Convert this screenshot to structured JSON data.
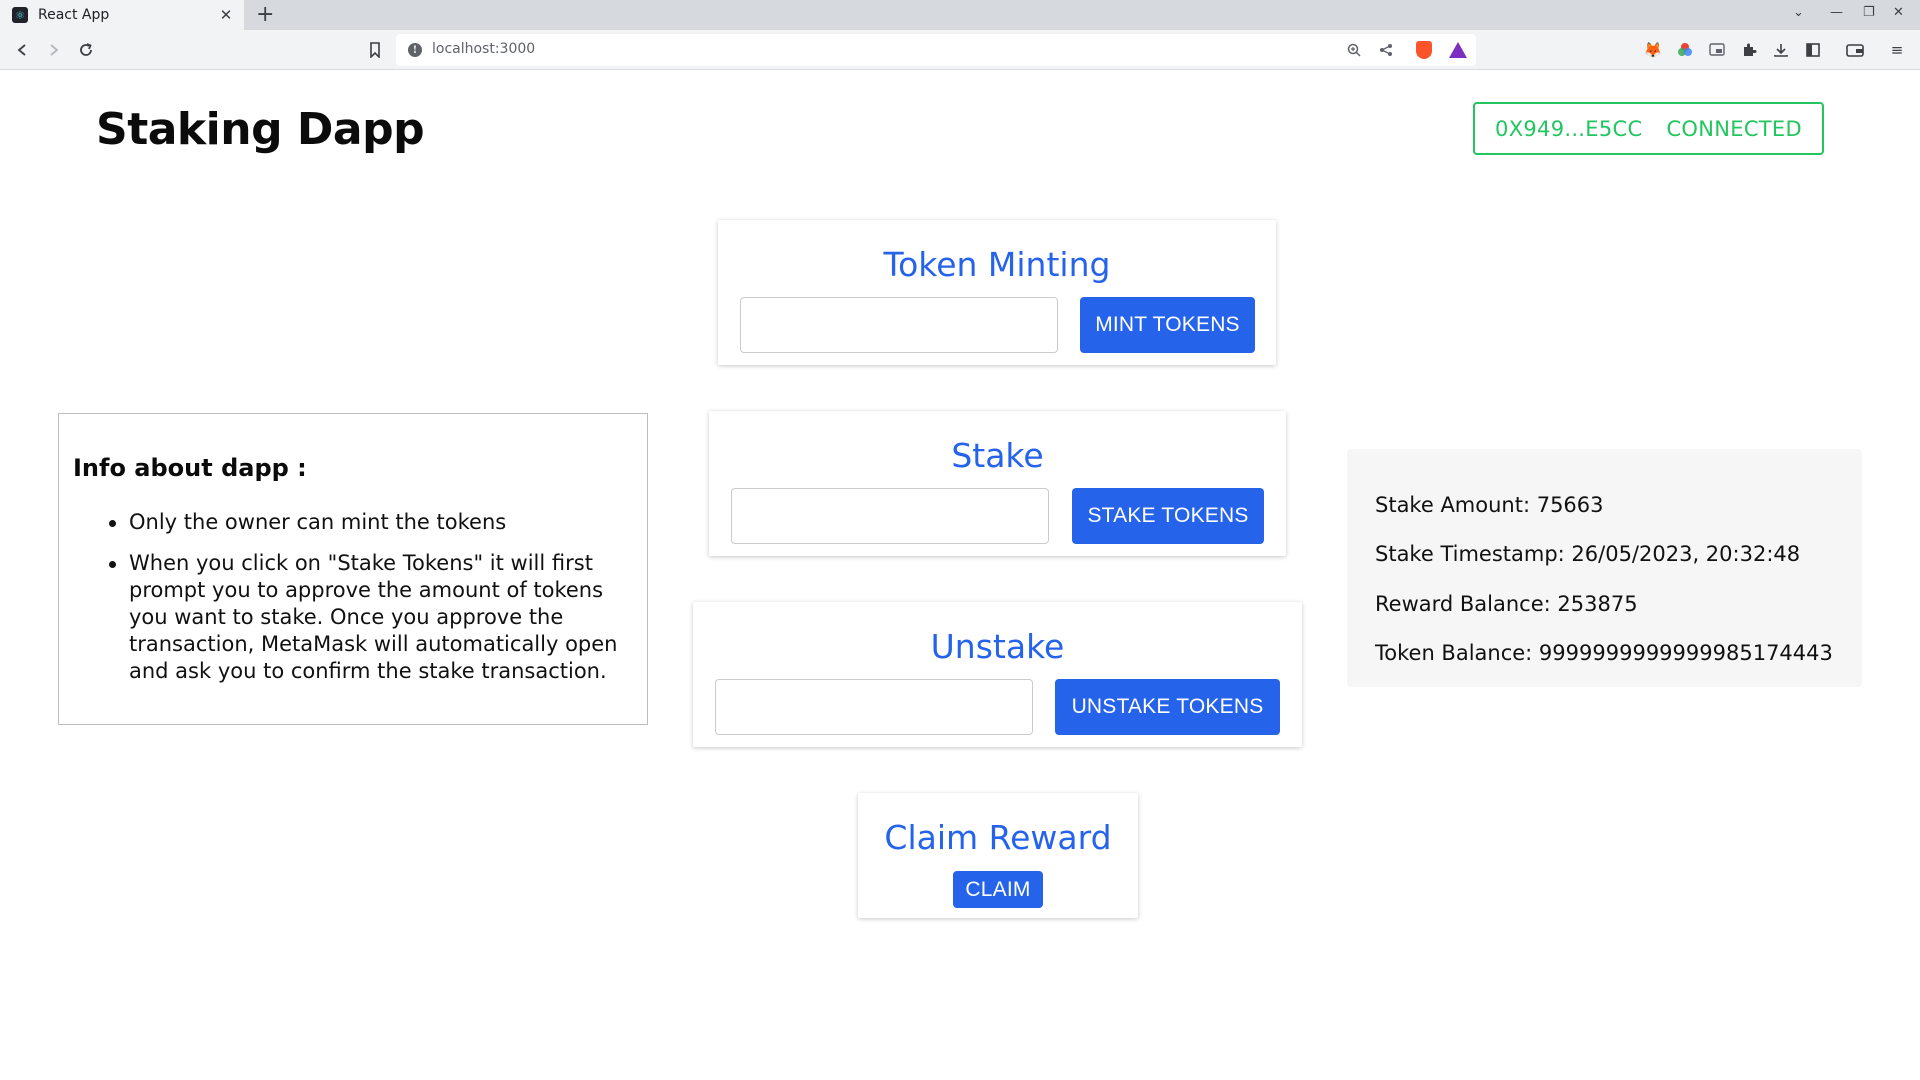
{
  "browser": {
    "tab_title": "React App",
    "url": "localhost:3000"
  },
  "header": {
    "app_title": "Staking Dapp",
    "wallet_address": "0X949...E5CC",
    "wallet_status": "CONNECTED",
    "accent_color": "#22c55e"
  },
  "cards": {
    "mint": {
      "title": "Token Minting",
      "input_value": "",
      "button_label": "MINT TOKENS"
    },
    "stake": {
      "title": "Stake",
      "input_value": "",
      "button_label": "STAKE TOKENS"
    },
    "unstake": {
      "title": "Unstake",
      "input_value": "",
      "button_label": "UNSTAKE TOKENS"
    },
    "claim": {
      "title": "Claim Reward",
      "button_label": "CLAIM"
    },
    "primary_color": "#2563eb"
  },
  "info": {
    "title": "Info about dapp :",
    "items": [
      "Only the owner can mint the tokens",
      "When you click on \"Stake Tokens\" it will first prompt you to approve the amount of tokens you want to stake. Once you approve the transaction, MetaMask will automatically open and ask you to confirm the stake transaction."
    ]
  },
  "stats": {
    "stake_amount": "Stake Amount: 75663",
    "stake_timestamp": "Stake Timestamp: 26/05/2023, 20:32:48",
    "reward_balance": "Reward Balance: 253875",
    "token_balance": "Token Balance: 9999999999999985174443"
  },
  "icons": {
    "back": "back-icon",
    "forward": "forward-icon",
    "reload": "reload-icon",
    "bookmark": "bookmark-icon",
    "site_info": "info-icon",
    "zoom": "zoom-icon",
    "share": "share-icon",
    "brave": "brave-shields-icon",
    "rewards": "brave-rewards-icon",
    "metamask": "metamask-icon",
    "extensions": "puzzle-icon"
  }
}
